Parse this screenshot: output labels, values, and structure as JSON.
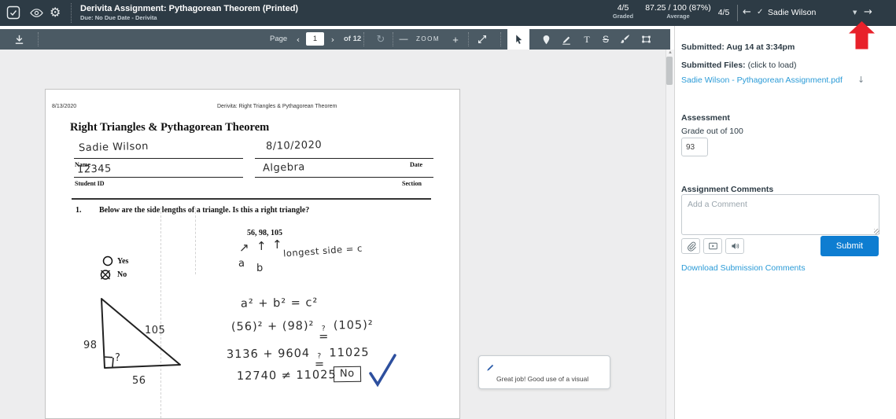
{
  "colors": {
    "topbar_bg": "#2d3b45",
    "toolbar_bg": "#4b5a64",
    "submit_blue": "#0e7dd1",
    "link_blue": "#2b9bd7",
    "arrow_red": "#e8212a",
    "check_blue": "#2d4f9e"
  },
  "topbar": {
    "title": "Derivita Assignment: Pythagorean Theorem (Printed)",
    "subtitle": "Due: No Due Date - Derivita",
    "stats": {
      "graded_value": "4/5",
      "graded_label": "Graded",
      "average_value": "87.25 / 100 (87%)",
      "average_label": "Average",
      "position_value": "4/5"
    },
    "nav": {
      "prev": "←",
      "check": "✓",
      "student_name": "Sadie Wilson",
      "caret": "▼",
      "next": "→"
    }
  },
  "toolbar": {
    "page_label": "Page",
    "page_prev": "‹",
    "page_value": "1",
    "page_next": "›",
    "page_total": "of 12",
    "rotate": "↻",
    "zoom_out": "—",
    "zoom_label": "ZOOM",
    "zoom_in": "+",
    "text_tool": "T",
    "strikeout_tool": "S"
  },
  "document": {
    "header_date": "8/13/2020",
    "header_title": "Derivita: Right Triangles & Pythagorean Theorem",
    "title": "Right Triangles & Pythagorean Theorem",
    "fields": {
      "name_value": "Sadie Wilson",
      "name_label": "Name",
      "date_value": "8/10/2020",
      "date_label": "Date",
      "id_value": "12345",
      "id_label": "Student ID",
      "section_value": "Algebra",
      "section_label": "Section"
    },
    "question": {
      "number": "1.",
      "text": "Below are the side lengths of a triangle. Is this a right triangle?",
      "sides": "56, 98, 105",
      "yes_label": "Yes",
      "no_label": "No"
    },
    "handwriting": {
      "arrow1": "↗",
      "arrow2": "↑",
      "arrow3": "↑",
      "label_a": "a",
      "label_b": "b",
      "note": "longest side = c",
      "eq1": "a² + b² = c²",
      "eq2_lhs": "(56)² + (98)²",
      "eq2_rhs": "(105)²",
      "eq3_lhs": "3136 + 9604",
      "eq3_rhs": "11025",
      "qmark": "?",
      "eqsign": "=",
      "eq4": "12740 ≠ 11025",
      "answer_box": "No",
      "tri_hyp": "105",
      "tri_left": "98",
      "tri_bottom": "56",
      "tri_angle": "?"
    },
    "comment_card": {
      "text": "Great job! Good use of a visual"
    }
  },
  "sidebar": {
    "submitted": "Submitted: Aug 14 at 3:34pm",
    "files_label": "Submitted Files:",
    "files_hint": " (click to load)",
    "file_link": "Sadie Wilson - Pythagorean Assignment.pdf",
    "file_download": "↓",
    "assessment_title": "Assessment",
    "grade_label": "Grade out of 100",
    "grade_value": "93",
    "comments_title": "Assignment Comments",
    "comment_placeholder": "Add a Comment",
    "submit_label": "Submit",
    "download_link": "Download Submission Comments"
  }
}
